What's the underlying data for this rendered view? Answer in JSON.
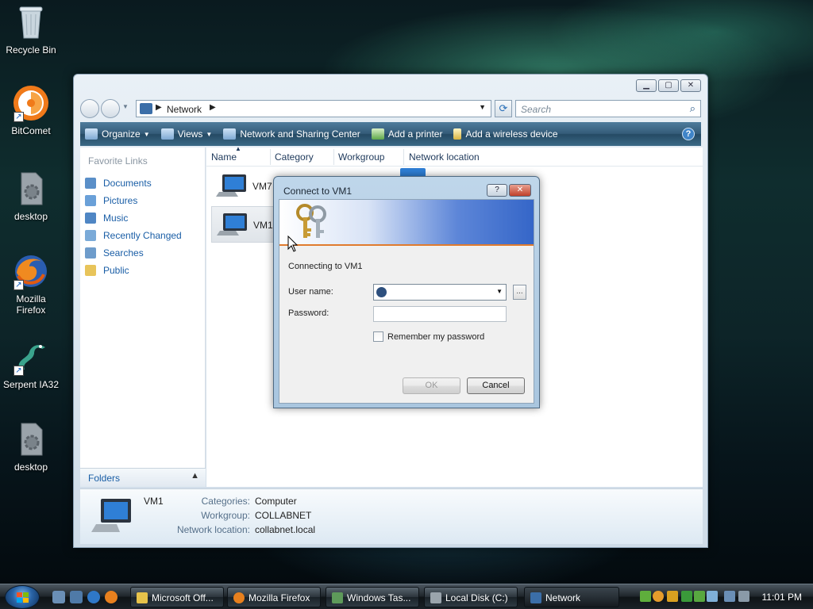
{
  "desktop": {
    "icons": [
      {
        "label": "Recycle Bin"
      },
      {
        "label": "BitComet"
      },
      {
        "label": "desktop"
      },
      {
        "label": "Mozilla Firefox"
      },
      {
        "label": "Serpent IA32"
      },
      {
        "label": "desktop"
      }
    ]
  },
  "explorer": {
    "address": "Network",
    "search_placeholder": "Search",
    "commands": [
      {
        "label": "Organize"
      },
      {
        "label": "Views"
      },
      {
        "label": "Network and Sharing Center"
      },
      {
        "label": "Add a printer"
      },
      {
        "label": "Add a wireless device"
      }
    ],
    "favorite_links_title": "Favorite Links",
    "favorite_links": [
      {
        "label": "Documents"
      },
      {
        "label": "Pictures"
      },
      {
        "label": "Music"
      },
      {
        "label": "Recently Changed"
      },
      {
        "label": "Searches"
      },
      {
        "label": "Public"
      }
    ],
    "folders_label": "Folders",
    "columns": [
      "Name",
      "Category",
      "Workgroup",
      "Network location"
    ],
    "items": [
      {
        "name": "VM7"
      },
      {
        "name": "VM1"
      }
    ],
    "details": {
      "name": "VM1",
      "categories_label": "Categories:",
      "categories_value": "Computer",
      "workgroup_label": "Workgroup:",
      "workgroup_value": "COLLABNET",
      "network_location_label": "Network location:",
      "network_location_value": "collabnet.local"
    }
  },
  "dialog": {
    "title": "Connect to VM1",
    "connecting_text": "Connecting to VM1",
    "username_label": "User name:",
    "username_value": "",
    "password_label": "Password:",
    "remember_label": "Remember my password",
    "ok_label": "OK",
    "cancel_label": "Cancel",
    "browse_label": "..."
  },
  "taskbar": {
    "tasks": [
      {
        "label": "Microsoft Off..."
      },
      {
        "label": "Mozilla Firefox"
      },
      {
        "label": "Windows Tas..."
      },
      {
        "label": "Local Disk (C:)"
      },
      {
        "label": "Network"
      }
    ],
    "clock": "11:01 PM"
  },
  "colors": {
    "accent": "#1a5ea6",
    "command_bar": "#355c79",
    "banner_orange": "#e07b2e"
  }
}
